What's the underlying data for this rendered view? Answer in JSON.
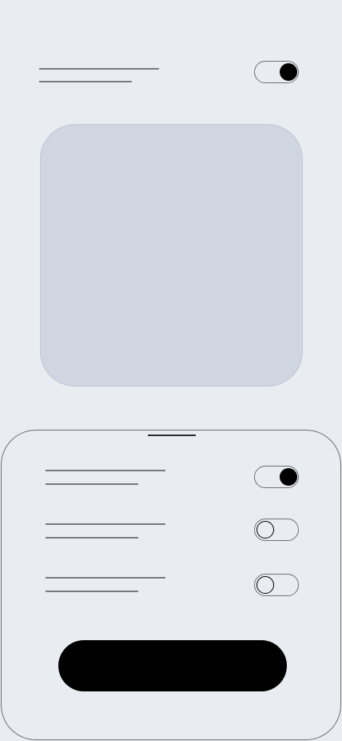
{
  "header_setting": {
    "title": "",
    "subtitle": "",
    "toggle_on": true
  },
  "image_placeholder": {
    "label": ""
  },
  "settings_sheet": {
    "items": [
      {
        "title": "",
        "subtitle": "",
        "toggle_on": true
      },
      {
        "title": "",
        "subtitle": "",
        "toggle_on": false
      },
      {
        "title": "",
        "subtitle": "",
        "toggle_on": false
      }
    ],
    "primary_button_label": ""
  },
  "colors": {
    "background": "#e9edf1",
    "placeholder_fill": "#d0d6e0",
    "toggle_knob_on": "#000000",
    "button": "#000000"
  }
}
